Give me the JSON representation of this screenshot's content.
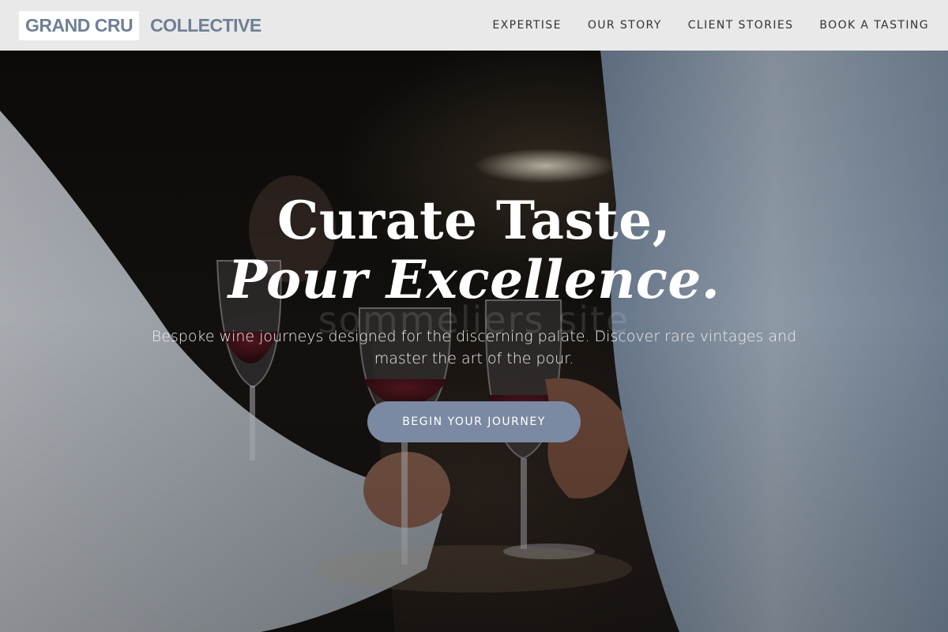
{
  "header": {
    "logo_primary": "GRAND CRU",
    "logo_secondary": "COLLECTIVE",
    "nav": [
      {
        "label": "EXPERTISE"
      },
      {
        "label": "OUR STORY"
      },
      {
        "label": "CLIENT STORIES"
      },
      {
        "label": "BOOK A TASTING"
      }
    ]
  },
  "hero": {
    "headline_line1": "Curate Taste,",
    "headline_line2": "Pour Excellence.",
    "ghost_text": "sommeliers site",
    "subtext": "Bespoke wine journeys designed for the discerning palate. Discover rare vintages and master the art of the pour.",
    "cta_label": "BEGIN YOUR JOURNEY"
  },
  "colors": {
    "accent": "#7b8aa2",
    "logo": "#6f7f96",
    "header_bg": "#f2f2f2"
  }
}
